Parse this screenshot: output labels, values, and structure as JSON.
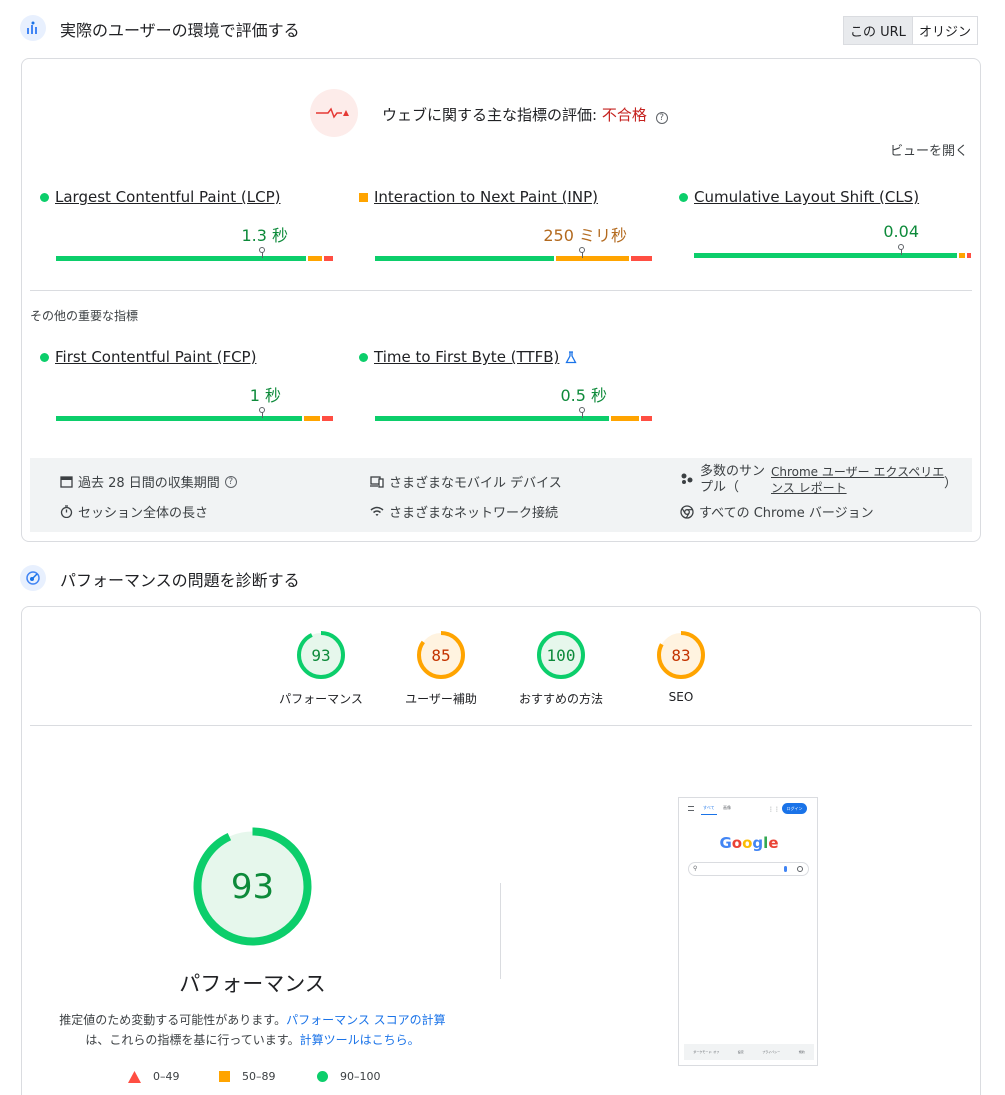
{
  "field_section": {
    "title": "実際のユーザーの環境で評価する",
    "toggle": [
      "この URL",
      "オリジン"
    ],
    "cwv_label": "ウェブに関する主な指標の評価: ",
    "cwv_result": "不合格",
    "expand_view": "ビューを開く",
    "metrics": [
      {
        "name": "Largest Contentful Paint (LCP)",
        "value": "1.3 秒",
        "status": "good"
      },
      {
        "name": "Interaction to Next Paint (INP)",
        "value": "250 ミリ秒",
        "status": "needs-improvement"
      },
      {
        "name": "Cumulative Layout Shift (CLS)",
        "value": "0.04",
        "status": "good"
      }
    ],
    "other_heading": "その他の重要な指標",
    "other_metrics": [
      {
        "name": "First Contentful Paint (FCP)",
        "value": "1 秒",
        "status": "good"
      },
      {
        "name": "Time to First Byte (TTFB)",
        "value": "0.5 秒",
        "status": "good"
      }
    ],
    "footer": {
      "period": "過去 28 日間の収集期間",
      "session": "セッション全体の長さ",
      "devices": "さまざまなモバイル デバイス",
      "network": "さまざまなネットワーク接続",
      "samples_prefix": "多数のサンプル（",
      "samples_link": "Chrome ユーザー エクスペリエンス レポート",
      "samples_suffix": "）",
      "chrome": "すべての Chrome バージョン"
    }
  },
  "lab_section": {
    "title": "パフォーマンスの問題を診断する",
    "scores": [
      {
        "value": "93",
        "label": "パフォーマンス",
        "color": "#0cce6b",
        "bg": "#e6f7ec",
        "text": "#0d8a3a"
      },
      {
        "value": "85",
        "label": "ユーザー補助",
        "color": "#ffa400",
        "bg": "#fff3e0",
        "text": "#c33300"
      },
      {
        "value": "100",
        "label": "おすすめの方法",
        "color": "#0cce6b",
        "bg": "#e6f7ec",
        "text": "#0d8a3a"
      },
      {
        "value": "83",
        "label": "SEO",
        "color": "#ffa400",
        "bg": "#fff3e0",
        "text": "#c33300"
      }
    ],
    "big_score": "93",
    "big_label": "パフォーマンス",
    "desc_1": "推定値のため変動する可能性があります。",
    "desc_link1": "パフォーマンス スコアの計算",
    "desc_2": "は、これらの指標を基に行っています。",
    "desc_link2": "計算ツールはこちら。",
    "legend": [
      "0–49",
      "50–89",
      "90–100"
    ],
    "screenshot": {
      "tab_all": "すべて",
      "tab_images": "画像",
      "login": "ログイン",
      "logo": "Google",
      "footer_items": [
        "ダークモード: オフ",
        "設定",
        "プライバシー",
        "規約"
      ]
    }
  }
}
